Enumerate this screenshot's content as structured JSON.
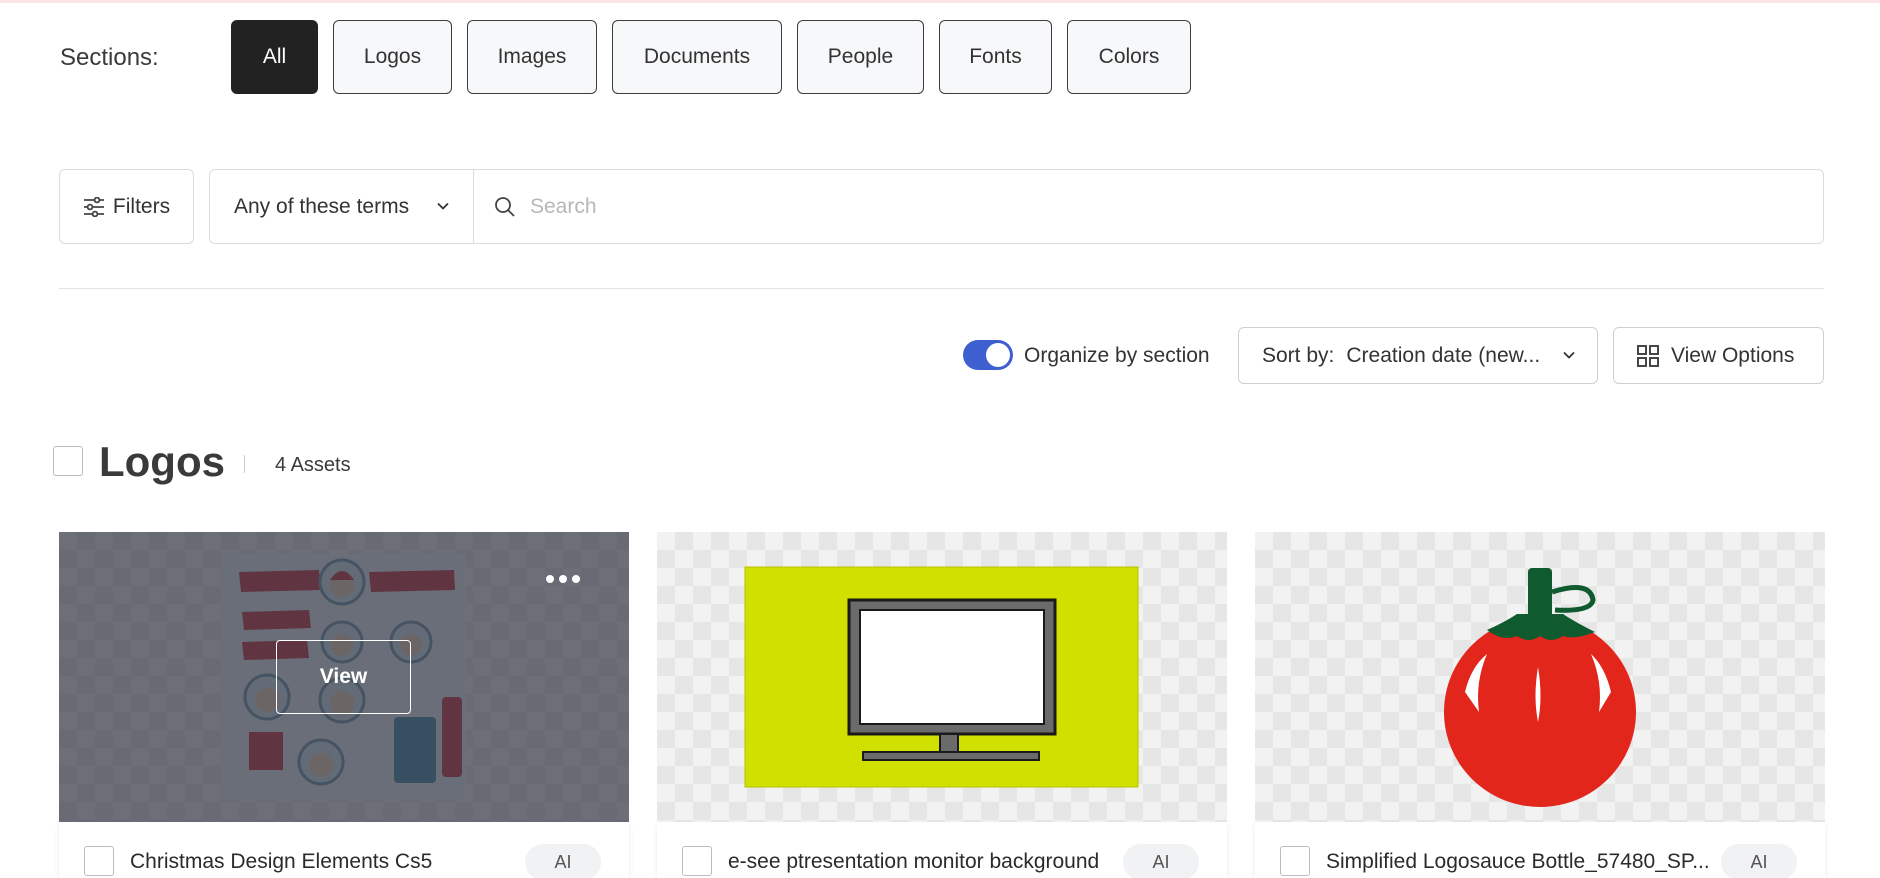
{
  "sections": {
    "label": "Sections:",
    "items": [
      {
        "label": "All",
        "active": true
      },
      {
        "label": "Logos"
      },
      {
        "label": "Images"
      },
      {
        "label": "Documents"
      },
      {
        "label": "People"
      },
      {
        "label": "Fonts"
      },
      {
        "label": "Colors"
      }
    ]
  },
  "search": {
    "filters_label": "Filters",
    "terms_mode": "Any of these terms",
    "placeholder": "Search"
  },
  "controls": {
    "organize_label": "Organize by section",
    "organize_on": true,
    "sort_prefix": "Sort by:",
    "sort_value": "Creation date (new...",
    "view_options_label": "View Options"
  },
  "section": {
    "title": "Logos",
    "count": "4 Assets"
  },
  "cards": [
    {
      "title": "Christmas Design Elements Cs5",
      "badge": "AI",
      "hover_action": "View",
      "icon": "christmas-santa-elements"
    },
    {
      "title": "e-see ptresentation monitor background",
      "badge": "AI",
      "icon": "monitor-on-yellow"
    },
    {
      "title": "Simplified Logosauce Bottle_57480_SP...",
      "badge": "AI",
      "icon": "tomato-sauce-bottle"
    }
  ],
  "colors": {
    "active_bg": "#222222",
    "toggle_on": "#3d5fd0",
    "monitor_bg": "#d2e000",
    "tomato_red": "#e2261c",
    "tomato_leaf": "#0f5a2e"
  }
}
